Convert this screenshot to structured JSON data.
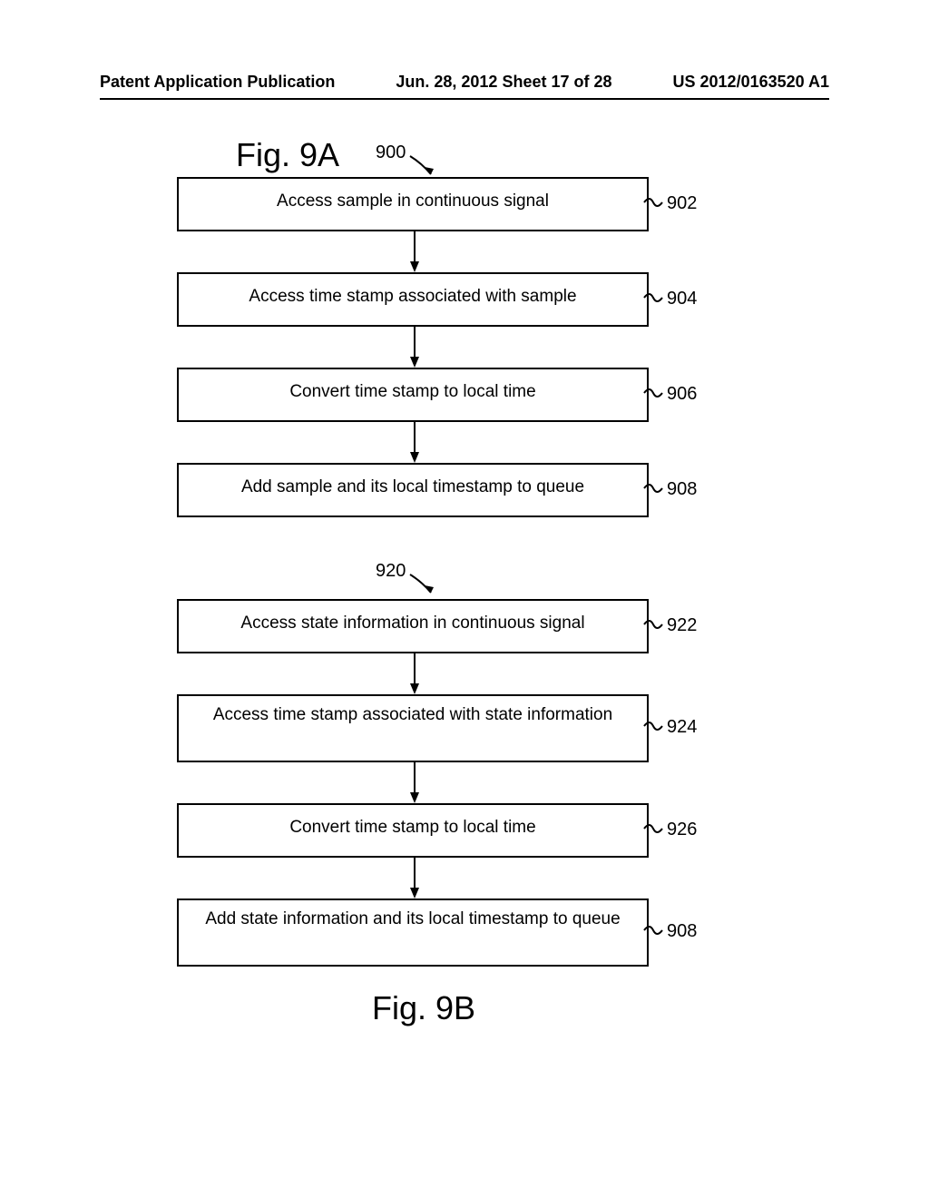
{
  "header": {
    "left": "Patent Application Publication",
    "center": "Jun. 28, 2012  Sheet 17 of 28",
    "right": "US 2012/0163520 A1"
  },
  "figA": {
    "title": "Fig. 9A",
    "ref": "900",
    "boxes": {
      "b902": {
        "text": "Access sample in continuous signal",
        "ref": "902"
      },
      "b904": {
        "text": "Access time stamp associated with sample",
        "ref": "904"
      },
      "b906": {
        "text": "Convert time stamp to local time",
        "ref": "906"
      },
      "b908": {
        "text": "Add sample and its local timestamp to queue",
        "ref": "908"
      }
    }
  },
  "figB": {
    "title": "Fig. 9B",
    "ref": "920",
    "boxes": {
      "b922": {
        "text": "Access state information in continuous signal",
        "ref": "922"
      },
      "b924": {
        "text": "Access time stamp associated with state information",
        "ref": "924"
      },
      "b926": {
        "text": "Convert time stamp to local time",
        "ref": "926"
      },
      "b928": {
        "text": "Add state information and its local timestamp to queue",
        "ref": "908"
      }
    }
  }
}
